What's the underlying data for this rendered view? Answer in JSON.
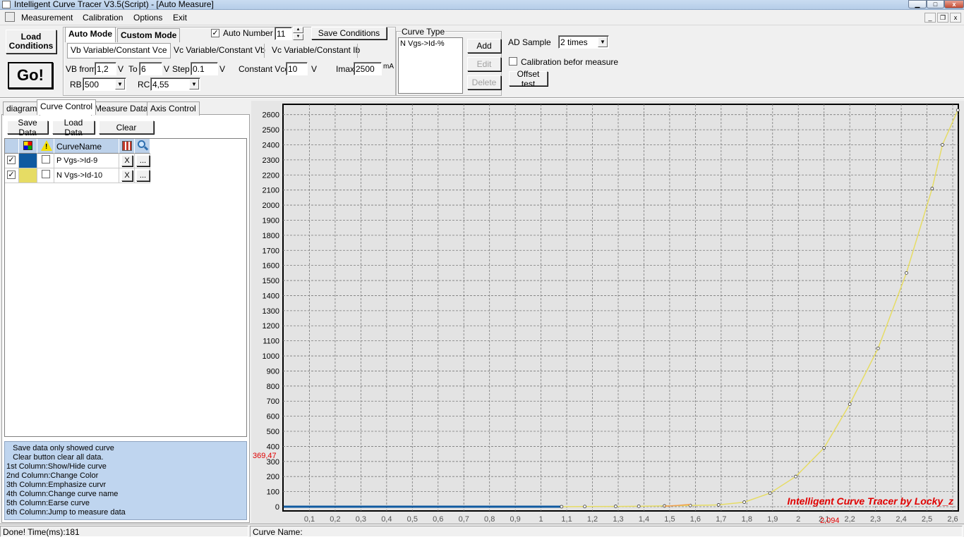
{
  "window": {
    "title": "Intelligent Curve Tracer V3.5(Script) - [Auto Measure]"
  },
  "menu": {
    "items": [
      "Measurement",
      "Calibration",
      "Options",
      "Exit"
    ]
  },
  "toolbar": {
    "load_conditions": "Load\nConditions",
    "go": "Go!",
    "mode_tabs": [
      "Auto Mode",
      "Custom Mode"
    ],
    "sub_tabs": [
      "Vb Variable/Constant Vce",
      "Vc Variable/Constant Vb",
      "Vc Variable/Constant Ib"
    ],
    "auto_number_label": "Auto Number",
    "auto_number_checked": true,
    "auto_number_value": "11",
    "save_conditions": "Save Conditions",
    "vb_from_label": "VB from",
    "vb_from_value": "1,2",
    "v_unit": "V",
    "to_label": "To",
    "to_value": "6",
    "step_label": "Step",
    "step_value": "0.1",
    "constant_vce_label": "Constant Vce",
    "constant_vce_value": "10",
    "imax_label": "Imax",
    "imax_value": "2500",
    "ma_unit": "mA",
    "rb_label": "RB",
    "rb_value": "500",
    "rc_label": "RC",
    "rc_value": "4,55",
    "curve_type_title": "Curve Type",
    "curve_type_item": "N Vgs->Id-%",
    "add": "Add",
    "edit": "Edit",
    "delete": "Delete",
    "ad_sample_label": "AD Sample",
    "ad_sample_value": "2 times",
    "calibration_label": "Calibration befor measure",
    "calibration_checked": false,
    "offset_test": "Offset test"
  },
  "left_tabs": [
    "diagram",
    "Curve Control",
    "Measure Data",
    "Axis Control"
  ],
  "left_buttons": {
    "save": "Save Data",
    "load": "Load Data",
    "clear": "Clear"
  },
  "curve_grid": {
    "header_name": "CurveName",
    "rows": [
      {
        "checked": true,
        "color": "#0f5aa0",
        "emph": false,
        "name": "P Vgs->Id-9",
        "x": "X",
        "dots": "..."
      },
      {
        "checked": true,
        "color": "#e6dc64",
        "emph": false,
        "name": "N Vgs->Id-10",
        "x": "X",
        "dots": "..."
      }
    ]
  },
  "help_lines": [
    "   Save data only showed curve",
    "   Clear button clear all data.",
    "1st Column:Show/Hide curve",
    "2nd Column:Change Color",
    "3th Column:Emphasize curvr",
    "4th Column:Change curve name",
    "5th Column:Earse curve",
    "6th Column:Jump to measure data"
  ],
  "status": {
    "left": "Done!  Time(ms):181",
    "curve_name": "Curve Name:"
  },
  "colors": {
    "curve_p": "#0f5aa0",
    "curve_n": "#e6dc64",
    "marker_text": "#e00000"
  },
  "chart_data": {
    "type": "line",
    "xlim": [
      0,
      2.6
    ],
    "ylim": [
      0,
      2650
    ],
    "grid": true,
    "x_ticks": [
      "0,1",
      "0,2",
      "0,3",
      "0,4",
      "0,5",
      "0,6",
      "0,7",
      "0,8",
      "0,9",
      "1",
      "1,1",
      "1,2",
      "1,3",
      "1,4",
      "1,5",
      "1,6",
      "1,7",
      "1,8",
      "1,9",
      "2",
      "2,1",
      "2,2",
      "2,3",
      "2,4",
      "2,5",
      "2,6"
    ],
    "y_ticks": [
      "0",
      "100",
      "200",
      "300",
      "400",
      "500",
      "600",
      "700",
      "800",
      "900",
      "1000",
      "1100",
      "1200",
      "1300",
      "1400",
      "1500",
      "1600",
      "1700",
      "1800",
      "1900",
      "2000",
      "2100",
      "2200",
      "2300",
      "2400",
      "2500",
      "2600"
    ],
    "cursor_y_label": "369,47",
    "cursor_x_label": "2,094",
    "watermark": "Intelligent Curve Tracer by Locky_z",
    "series": [
      {
        "color": "#0f5aa0",
        "x": [
          0,
          1.08
        ],
        "y": [
          0,
          0
        ]
      },
      {
        "color": "#e6dc64",
        "x": [
          1.08,
          1.17,
          1.29,
          1.38,
          1.48,
          1.58,
          1.69,
          1.79,
          1.89,
          1.99,
          2.1,
          2.2,
          2.31,
          2.42,
          2.52,
          2.56,
          2.62
        ],
        "y": [
          0,
          1,
          2,
          3,
          5,
          8,
          12,
          30,
          90,
          200,
          390,
          680,
          1050,
          1550,
          2110,
          2400,
          2630
        ]
      },
      {
        "color": "#f0a050",
        "x": [
          1.48,
          1.53,
          1.58
        ],
        "y": [
          3,
          8,
          15
        ]
      }
    ]
  }
}
